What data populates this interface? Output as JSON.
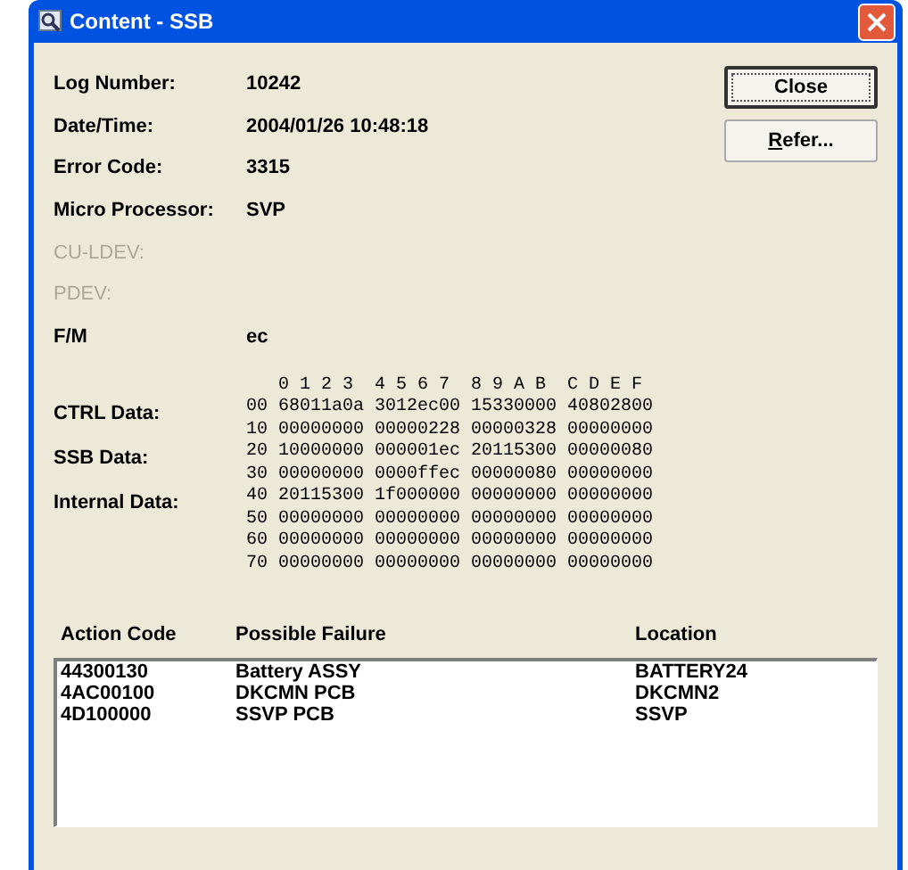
{
  "window": {
    "title": "Content - SSB"
  },
  "buttons": [
    {
      "label": "Close",
      "default": true
    },
    {
      "label": "efer...",
      "mnemonic": "R",
      "default": false
    }
  ],
  "fields": [
    {
      "label": "Log Number:",
      "value": "10242",
      "disabled": false
    },
    {
      "label": "Date/Time:",
      "value": "2004/01/26 10:48:18",
      "disabled": false
    },
    {
      "label": "Error Code:",
      "value": "3315",
      "disabled": false
    },
    {
      "label": "Micro Processor:",
      "value": "SVP",
      "disabled": false
    },
    {
      "label": "CU-LDEV:",
      "disabled": true
    },
    {
      "label": "PDEV:",
      "disabled": true
    },
    {
      "label": "F/M",
      "value": "ec",
      "disabled": false
    }
  ],
  "data_labels": [
    "CTRL Data:",
    "SSB Data:",
    "Internal Data:"
  ],
  "hex_header": "0 1 2 3  4 5 6 7  8 9 A B  C D E F",
  "hex_rows": [
    "00 68011a0a 3012ec00 15330000 40802800",
    "10 00000000 00000228 00000328 00000000",
    "20 10000000 000001ec 20115300 00000080",
    "30 00000000 0000ffec 00000080 00000000",
    "40 20115300 1f000000 00000000 00000000",
    "50 00000000 00000000 00000000 00000000",
    "60 00000000 00000000 00000000 00000000",
    "70 00000000 00000000 00000000 00000000"
  ],
  "table": {
    "columns": [
      "Action Code",
      "Possible Failure",
      "Location"
    ],
    "rows": [
      [
        "44300130",
        "Battery ASSY",
        "BATTERY24"
      ],
      [
        "4AC00100",
        "DKCMN PCB",
        "DKCMN2"
      ],
      [
        "4D100000",
        "SSVP PCB",
        "SSVP"
      ]
    ]
  }
}
